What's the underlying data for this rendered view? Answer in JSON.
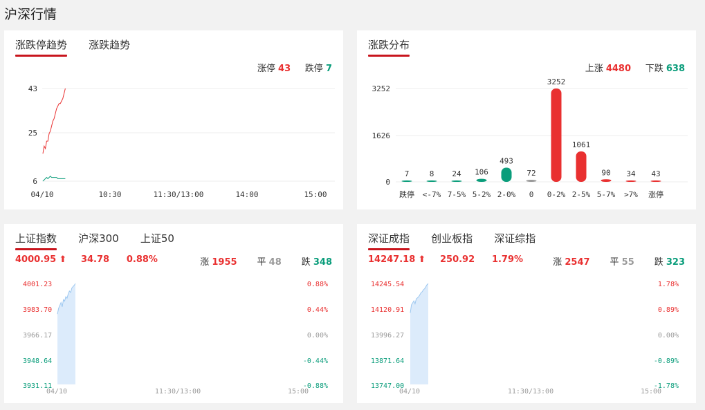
{
  "page_title": "沪深行情",
  "panel1": {
    "tabs": [
      "涨跌停趋势",
      "涨跌趋势"
    ],
    "limit_up_label": "涨停",
    "limit_up_value": "43",
    "limit_down_label": "跌停",
    "limit_down_value": "7",
    "y_ticks": [
      "43",
      "25",
      "6"
    ],
    "x_ticks": [
      "04/10",
      "10:30",
      "11:30/13:00",
      "14:00",
      "15:00"
    ]
  },
  "panel2": {
    "tabs": [
      "涨跌分布"
    ],
    "up_label": "上涨",
    "up_value": "4480",
    "down_label": "下跌",
    "down_value": "638"
  },
  "panel3": {
    "tabs": [
      "上证指数",
      "沪深300",
      "上证50"
    ],
    "price": "4000.95",
    "change": "34.78",
    "change_pct": "0.88%",
    "up_label": "涨",
    "up_count": "1955",
    "flat_label": "平",
    "flat_count": "48",
    "down_label": "跌",
    "down_count": "348",
    "left_ticks": [
      "4001.23",
      "3983.70",
      "3966.17",
      "3948.64",
      "3931.11"
    ],
    "right_ticks": [
      "0.88%",
      "0.44%",
      "0.00%",
      "-0.44%",
      "-0.88%"
    ],
    "x_ticks": [
      "04/10",
      "11:30/13:00",
      "15:00"
    ]
  },
  "panel4": {
    "tabs": [
      "深证成指",
      "创业板指",
      "深证综指"
    ],
    "price": "14247.18",
    "change": "250.92",
    "change_pct": "1.79%",
    "up_label": "涨",
    "up_count": "2547",
    "flat_label": "平",
    "flat_count": "55",
    "down_label": "跌",
    "down_count": "323",
    "left_ticks": [
      "14245.54",
      "14120.91",
      "13996.27",
      "13871.64",
      "13747.00"
    ],
    "right_ticks": [
      "1.78%",
      "0.89%",
      "0.00%",
      "-0.89%",
      "-1.78%"
    ],
    "x_ticks": [
      "04/10",
      "11:30/13:00",
      "15:00"
    ]
  },
  "chart_data": [
    {
      "type": "line",
      "x_ticks": [
        "04/10",
        "10:30",
        "11:30/13:00",
        "14:00",
        "15:00"
      ],
      "ylim": [
        6,
        43
      ],
      "series": [
        {
          "name": "涨停",
          "values": [
            17,
            20,
            19,
            22,
            22,
            25,
            26,
            28,
            30,
            31,
            33,
            35,
            36,
            37,
            37,
            38,
            39,
            41,
            43
          ]
        },
        {
          "name": "跌停",
          "values": [
            6,
            6.5,
            7,
            7.5,
            7,
            7.5,
            8,
            7.5,
            7.5,
            7.5,
            7.5,
            7.5,
            7,
            7,
            7,
            7,
            7,
            7,
            7
          ]
        }
      ],
      "colors": {
        "up": "#e93030",
        "down": "#0a9d7b"
      }
    },
    {
      "type": "bar",
      "categories": [
        "跌停",
        "<-7%",
        "7-5%",
        "5-2%",
        "2-0%",
        "0",
        "0-2%",
        "2-5%",
        "5-7%",
        ">7%",
        "涨停"
      ],
      "values": [
        7,
        8,
        24,
        106,
        493,
        72,
        3252,
        1061,
        90,
        34,
        43
      ],
      "bar_colors": [
        "#0a9d7b",
        "#0a9d7b",
        "#0a9d7b",
        "#0a9d7b",
        "#0a9d7b",
        "#999999",
        "#e93030",
        "#e93030",
        "#e93030",
        "#e93030",
        "#e93030"
      ],
      "y_ticks": [
        "3252",
        "1626",
        "0"
      ],
      "ylim": [
        0,
        3252
      ]
    },
    {
      "type": "area",
      "x_ticks": [
        "04/10",
        "11:30/13:00",
        "15:00"
      ],
      "ylim": [
        3931.11,
        4001.23
      ],
      "values": [
        3980,
        3984,
        3986,
        3988,
        3985,
        3990,
        3989,
        3992,
        3991,
        3994,
        3996,
        3995,
        3998,
        3999,
        4000,
        4001.2
      ]
    },
    {
      "type": "area",
      "x_ticks": [
        "04/10",
        "11:30/13:00",
        "15:00"
      ],
      "ylim": [
        13747.0,
        14245.54
      ],
      "values": [
        14100,
        14140,
        14150,
        14160,
        14145,
        14170,
        14175,
        14180,
        14190,
        14200,
        14205,
        14215,
        14220,
        14230,
        14240,
        14245
      ]
    }
  ]
}
